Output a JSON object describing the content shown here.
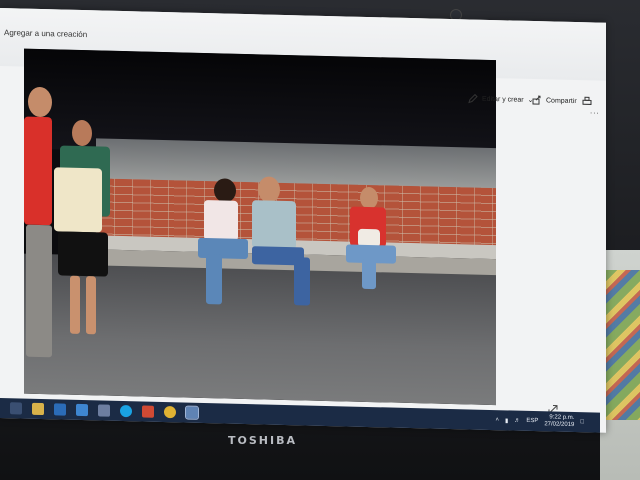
{
  "window": {
    "title": "Agregar a una creación"
  },
  "toolbar": {
    "tools": [
      "zoom-icon",
      "delete-icon",
      "favorite-icon",
      "rotate-icon"
    ],
    "edit_label": "Editar y crear",
    "share_label": "Compartir",
    "more": "..."
  },
  "taskbar": {
    "tray": {
      "keyboard": "ESP",
      "time": "9:22 p.m.",
      "date": "27/02/2019"
    }
  },
  "device": {
    "brand": "TOSHIBA"
  },
  "colors": {
    "taskbar": "#1b2b45",
    "window_bg": "#f2f3f4",
    "brick": "#b4533a"
  }
}
